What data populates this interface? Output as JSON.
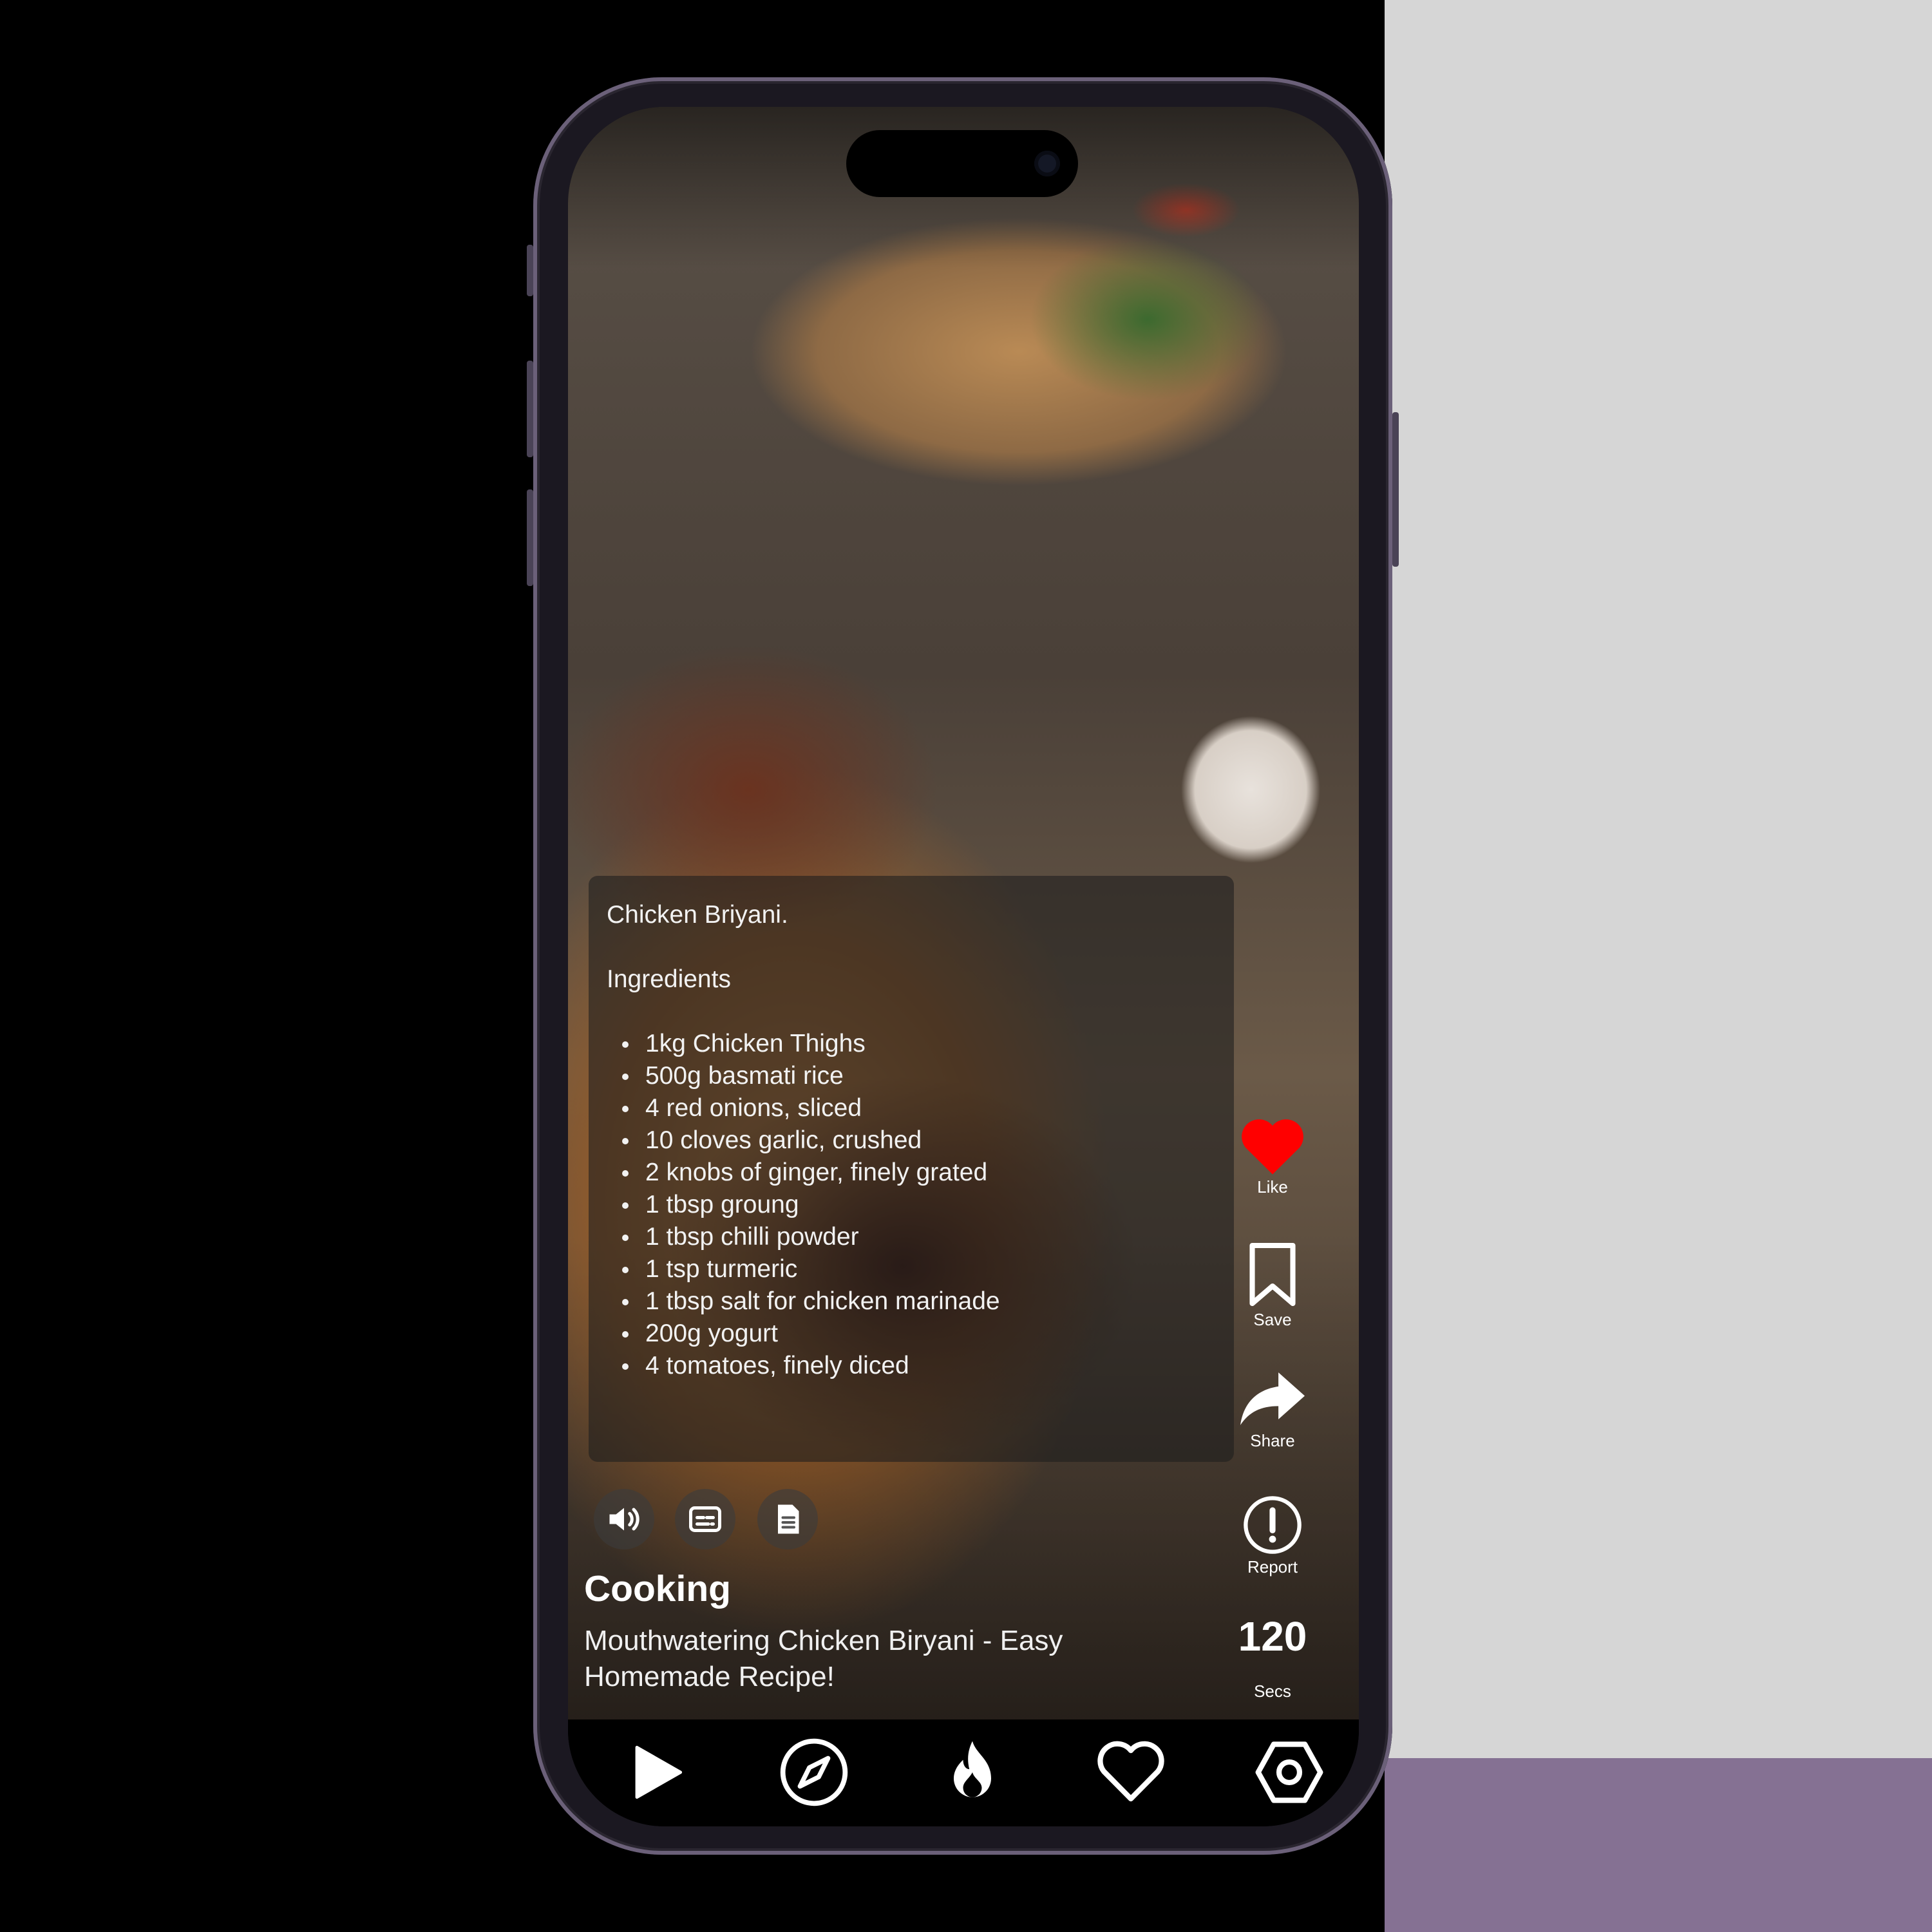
{
  "recipe_card": {
    "title": "Chicken Briyani.",
    "ingredients_heading": "Ingredients",
    "ingredients": [
      "1kg Chicken Thighs",
      "500g basmati rice",
      "4 red onions, sliced",
      "10 cloves garlic, crushed",
      "2 knobs of ginger, finely grated",
      "1 tbsp groung",
      "1 tbsp chilli powder",
      "1 tsp turmeric",
      "1 tbsp salt for chicken marinade",
      "200g yogurt",
      "4 tomatoes, finely diced"
    ]
  },
  "video": {
    "category": "Cooking",
    "title": "Mouthwatering Chicken Biryani - Easy Homemade Recipe!"
  },
  "controls": [
    {
      "icon": "speaker-icon"
    },
    {
      "icon": "subtitles-icon"
    },
    {
      "icon": "document-icon"
    }
  ],
  "side_actions": {
    "like": {
      "label": "Like",
      "icon": "heart-filled-icon",
      "color": "#ff0000"
    },
    "save": {
      "label": "Save",
      "icon": "bookmark-icon"
    },
    "share": {
      "label": "Share",
      "icon": "share-arrow-icon"
    },
    "report": {
      "label": "Report",
      "icon": "alert-circle-icon"
    }
  },
  "timer": {
    "value": "120",
    "unit": "Secs"
  },
  "tab_bar": [
    {
      "icon": "play-icon"
    },
    {
      "icon": "compass-icon"
    },
    {
      "icon": "flame-icon"
    },
    {
      "icon": "heart-outline-icon"
    },
    {
      "icon": "hexagon-settings-icon"
    }
  ],
  "colors": {
    "like": "#ff0000",
    "card_background": "rgba(30,30,30,0.58)",
    "background_right": "#d6d6d6",
    "background_accent": "#857193"
  }
}
